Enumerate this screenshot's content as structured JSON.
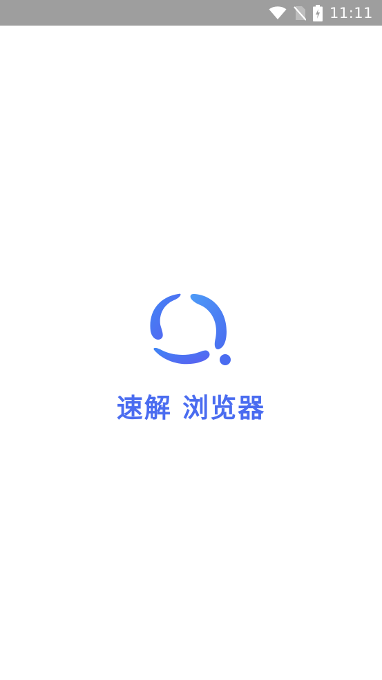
{
  "status_bar": {
    "time": "11:11",
    "icons": [
      "wifi-icon",
      "no-sim-icon",
      "battery-charging-icon"
    ],
    "background_color": "#9e9e9e"
  },
  "splash": {
    "app_name": "速解 浏览器",
    "logo": "app-logo",
    "brand_color": "#4a6cf0",
    "background_color": "#ffffff"
  }
}
